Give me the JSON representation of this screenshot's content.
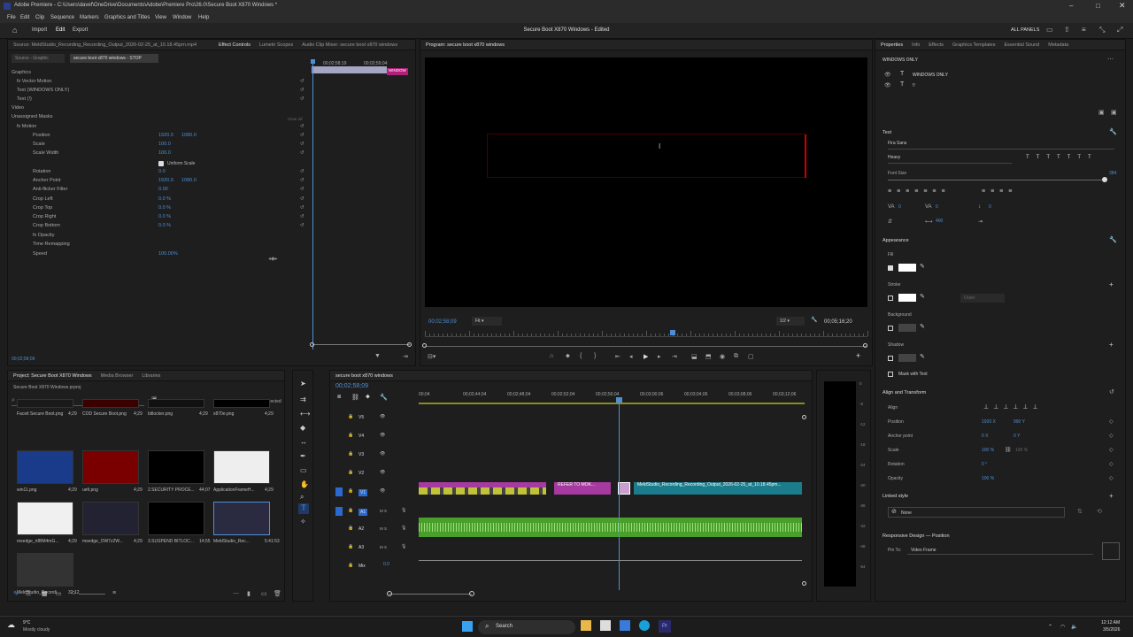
{
  "window": {
    "title": "Adobe Premiere - C:\\Users\\davef\\OneDrive\\Documents\\Adobe\\Premiere Pro\\26.0\\Secure Boot X870 Windows *"
  },
  "menu": [
    "File",
    "Edit",
    "Clip",
    "Sequence",
    "Markers",
    "Graphics and Titles",
    "View",
    "Window",
    "Help"
  ],
  "workspace": {
    "home": "Import",
    "edit": "Edit",
    "export": "Export",
    "center_title": "Secure Boot X870 Windows - Edited",
    "all_panels": "ALL PANELS"
  },
  "effect_controls": {
    "tabs": [
      "Source: MeldStudio_Recording_Recording_Output_2026-02-25_at_10.18.45pm.mp4",
      "Effect Controls",
      "Lumetri Scopes",
      "Audio Clip Mixer: secure boot x870 windows"
    ],
    "source_sel": "Source - Graphic",
    "clip_sel": "secure boot x870 windows - STOP",
    "timecode_a": "00;02;58;19",
    "timecode_b": "00;02;59;04",
    "mini_clip": "WINDOW",
    "items": [
      {
        "label": "Graphics",
        "v1": "",
        "v2": ""
      },
      {
        "label": "fx  Vector Motion",
        "v1": "",
        "v2": ""
      },
      {
        "label": "Text (WINDOWS ONLY)",
        "v1": "",
        "v2": ""
      },
      {
        "label": "Text (!)",
        "v1": "",
        "v2": ""
      },
      {
        "label": "Video",
        "v1": "",
        "v2": ""
      },
      {
        "label": "Unassigned Masks",
        "v1": "",
        "v2": ""
      },
      {
        "label": "fx  Motion",
        "v1": "",
        "v2": ""
      },
      {
        "label": "Position",
        "v1": "1920.0",
        "v2": "1080.0"
      },
      {
        "label": "Scale",
        "v1": "100.0",
        "v2": ""
      },
      {
        "label": "Scale Width",
        "v1": "100.0",
        "v2": ""
      },
      {
        "label": "",
        "v1": "",
        "v2": ""
      },
      {
        "label": "Rotation",
        "v1": "0.0",
        "v2": ""
      },
      {
        "label": "Anchor Point",
        "v1": "1920.0",
        "v2": "1080.0"
      },
      {
        "label": "Anti-flicker Filter",
        "v1": "0.00",
        "v2": ""
      },
      {
        "label": "Crop Left",
        "v1": "0.0 %",
        "v2": ""
      },
      {
        "label": "Crop Top",
        "v1": "0.0 %",
        "v2": ""
      },
      {
        "label": "Crop Right",
        "v1": "0.0 %",
        "v2": ""
      },
      {
        "label": "Crop Bottom",
        "v1": "0.0 %",
        "v2": ""
      },
      {
        "label": "fx  Opacity",
        "v1": "",
        "v2": ""
      },
      {
        "label": "Time Remapping",
        "v1": "",
        "v2": ""
      },
      {
        "label": "Speed",
        "v1": "100.00%",
        "v2": ""
      }
    ],
    "clear_all": "Clear all",
    "uniform_scale": "Uniform Scale",
    "timecode": "00;02;58;09"
  },
  "program": {
    "tab": "Program: secure boot x870 windows",
    "timecode": "00;02;58;09",
    "fit": "Fit",
    "resolution": "1/2",
    "duration": "00;05;16;20",
    "playhead": 0.56
  },
  "project": {
    "tabs": [
      "Project: Secure Boot X870 Windows",
      "Media Browser",
      "Libraries"
    ],
    "file": "Secure Boot X870 Windows.prproj",
    "selected": "1 of 17 items selected",
    "items": [
      {
        "name": "Faceit Secure Boot.png",
        "dur": "4;29"
      },
      {
        "name": "COD Secure Boot.png",
        "dur": "4;29"
      },
      {
        "name": "bitlocker.png",
        "dur": "4;29"
      },
      {
        "name": "x870e.png",
        "dur": "4;29"
      },
      {
        "name": "win11.png",
        "dur": "4;29"
      },
      {
        "name": "uefi.png",
        "dur": "4;29"
      },
      {
        "name": "2.SECURITY PROCE...",
        "dur": "44;07"
      },
      {
        "name": "ApplicationFrameH...",
        "dur": "4;29"
      },
      {
        "name": "msedge_rtIBM4mG...",
        "dur": "4;29"
      },
      {
        "name": "msedge_OW7z2W...",
        "dur": "4;29"
      },
      {
        "name": "3.SUSPEND BITLOC...",
        "dur": "14;55"
      },
      {
        "name": "MeldStudio_Rec...",
        "dur": "5:41:53"
      },
      {
        "name": "MeldStudio_Recordi...",
        "dur": "32;12"
      }
    ]
  },
  "timeline": {
    "tab": "secure boot x870 windows",
    "timecode": "00;02;58;09",
    "ruler": [
      "00;04",
      "00;02;44;04",
      "00;02;48;04",
      "00;02;52;04",
      "00;02;56;04",
      "00;03;00;06",
      "00;03;04;06",
      "00;03;08;06",
      "00;03;12;06"
    ],
    "tracks": [
      "V5",
      "V4",
      "V3",
      "V2",
      "V1",
      "A1",
      "A2",
      "A3",
      "Mix"
    ],
    "clip_labels": [
      "fx",
      "W",
      "fx",
      "fx",
      "EN",
      "fx",
      "THE",
      "REFER TO MOK...",
      "MeldStudio_Recording_Recording_Output_2026-02-25_at_10.18.45pm..."
    ],
    "mix_value": "0.0"
  },
  "meter": [
    "0",
    "-6",
    "-12",
    "-18",
    "-24",
    "-30",
    "-36",
    "-42",
    "-48",
    "-54"
  ],
  "properties": {
    "tabs": [
      "Properties",
      "Info",
      "Effects",
      "Graphics Templates",
      "Essential Sound",
      "Metadata"
    ],
    "layer_group": "WINDOWS ONLY",
    "layer1": "WINDOWS ONLY",
    "layer2": "!!",
    "text_head": "Text",
    "font": "Fira Sans",
    "style": "Heavy",
    "font_size_label": "Font Size",
    "font_size": "384",
    "tracking": "0",
    "kerning": "0",
    "leading": "0",
    "baseline": "400",
    "appearance": "Appearance",
    "fill": "Fill",
    "stroke": "Stroke",
    "stroke_pos": "Outer",
    "background": "Background",
    "shadow": "Shadow",
    "mask": "Mask with Text",
    "align_head": "Align and Transform",
    "align": "Align",
    "position_label": "Position",
    "pos_x": "1920 X",
    "pos_y": "990 Y",
    "anchor_label": "Anchor point",
    "anc_x": "0 X",
    "anc_y": "0 Y",
    "scale_label": "Scale",
    "scale": "100 %",
    "scale2": "100 %",
    "rotation_label": "Rotation",
    "rotation": "0 °",
    "opacity_label": "Opacity",
    "opacity": "100 %",
    "linked_style": "Linked style",
    "none": "None",
    "responsive": "Responsive Design — Position",
    "pin_to": "Pin To:",
    "pin_val": "Video Frame"
  },
  "taskbar": {
    "temp": "9°C",
    "weather": "Mostly cloudy",
    "search": "Search",
    "time": "12:12 AM",
    "date": "3/5/2026"
  }
}
